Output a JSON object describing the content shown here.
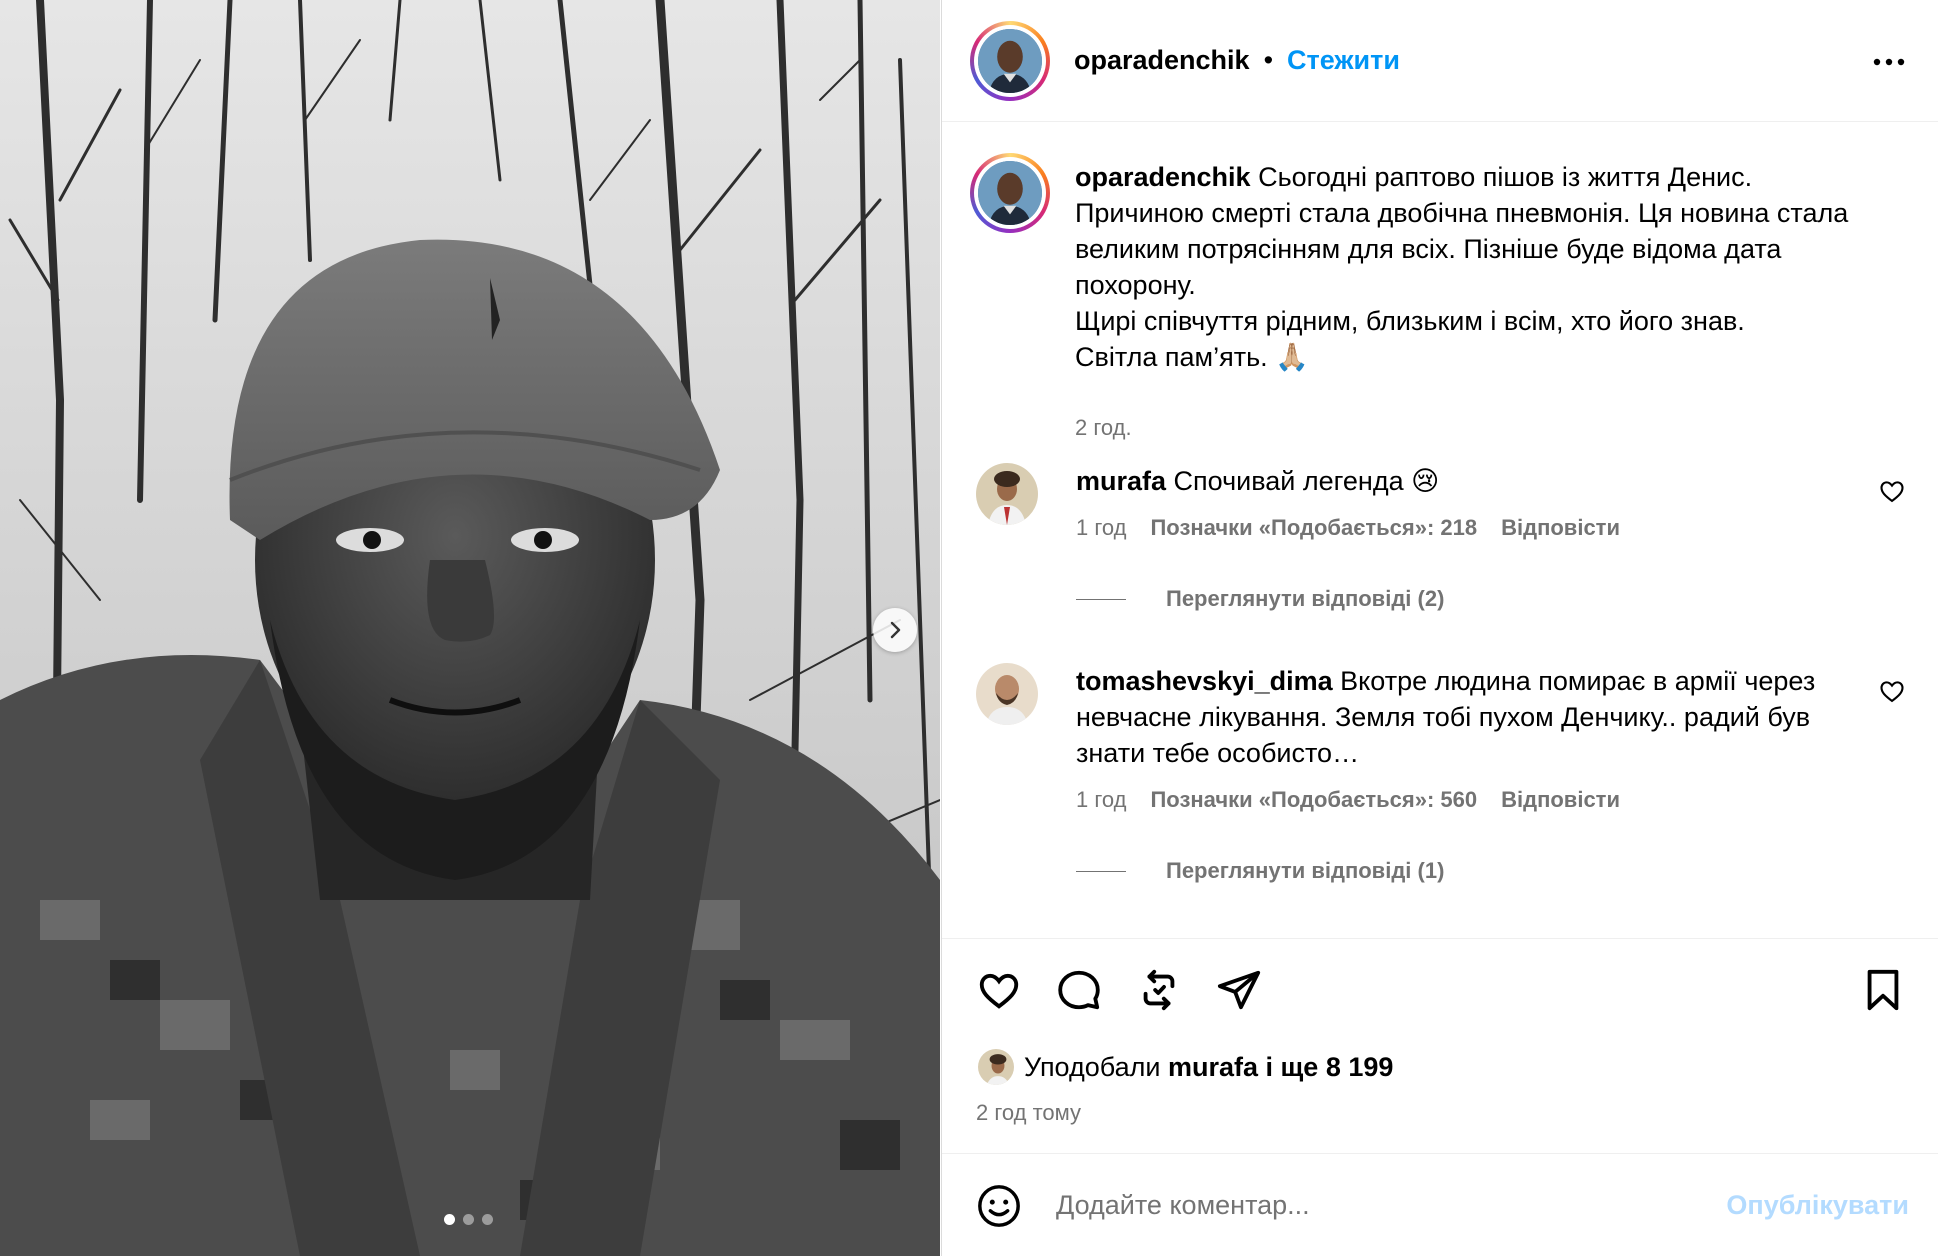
{
  "post": {
    "username": "oparadenchik",
    "separator": "•",
    "follow_label": "Стежити",
    "caption": {
      "username": "oparadenchik",
      "text": "Сьогодні раптово пішов із життя Денис. Причиною смерті стала двобічна пневмонія. Ця новина стала великим потрясінням для всіх. Пізніше буде відома дата похорону.",
      "text2": "Щирі співчуття рідним, близьким і всім, хто його знав.",
      "text3": "Світла пам’ять. 🙏🏼",
      "time": "2 год."
    },
    "carousel": {
      "slides": 3,
      "active": 0
    }
  },
  "comments": [
    {
      "username": "murafa",
      "text": "Спочивай легенда 😢",
      "time": "1 год",
      "likes": "Позначки «Подобається»: 218",
      "reply_label": "Відповісти",
      "view_replies": "Переглянути відповіді (2)"
    },
    {
      "username": "tomashevskyi_dima",
      "text": "Вкотре людина помирає в армії через невчасне лікування. Земля тобі пухом Денчику.. радий був знати тебе особисто…",
      "time": "1 год",
      "likes": "Позначки «Подобається»: 560",
      "reply_label": "Відповісти",
      "view_replies": "Переглянути відповіді (1)"
    }
  ],
  "likes": {
    "prefix": "Уподобали",
    "user": "murafa",
    "rest": "і ще 8 199"
  },
  "posted_time": "2 год тому",
  "comment_box": {
    "placeholder": "Додайте коментар...",
    "publish_label": "Опублікувати"
  },
  "colors": {
    "accent": "#0095f6",
    "publish_disabled": "#b3dbff",
    "secondary_text": "#737373"
  },
  "icons": [
    "next-arrow-icon",
    "more-icon",
    "heart-icon",
    "comment-icon",
    "repost-icon",
    "share-icon",
    "bookmark-icon",
    "emoji-icon"
  ]
}
